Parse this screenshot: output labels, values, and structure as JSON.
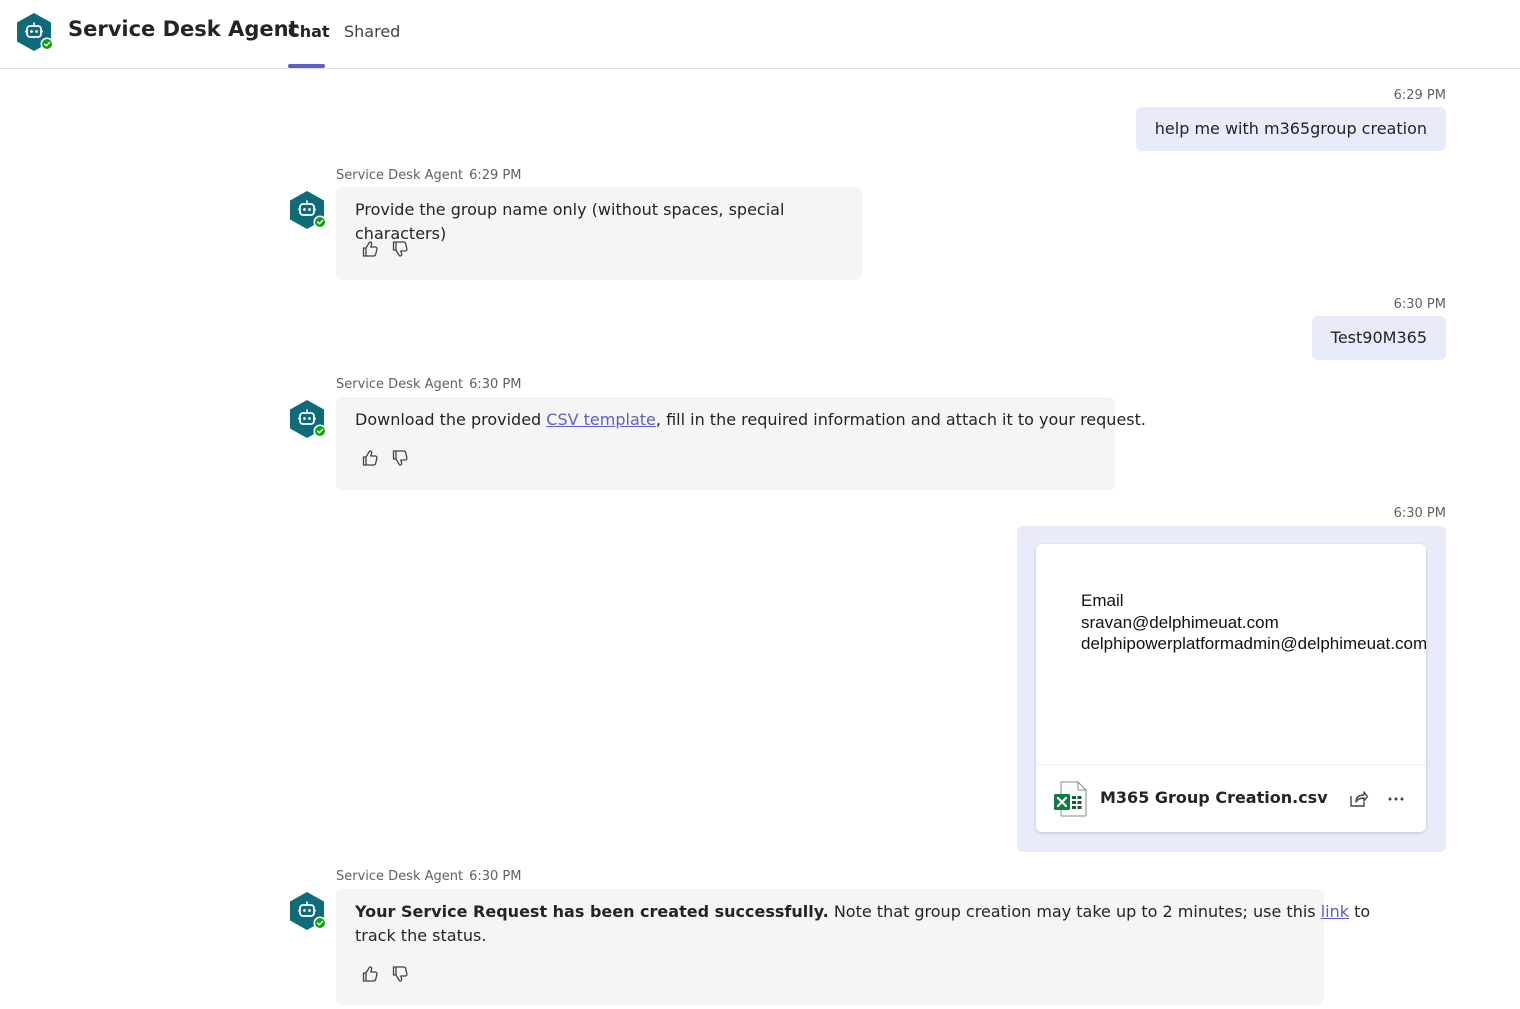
{
  "app": {
    "title": "Service Desk Agent",
    "tabs": [
      {
        "label": "Chat",
        "active": true
      },
      {
        "label": "Shared",
        "active": false
      }
    ],
    "accent_color": "#5b5fc7",
    "avatar_color": "#0f6b7a",
    "status_color": "#13a10e",
    "icons": {
      "avatar": "bot-hexagon-icon",
      "status": "available-check-icon",
      "like": "thumbs-up-icon",
      "dislike": "thumbs-down-icon",
      "file": "excel-csv-icon",
      "share": "share-icon",
      "more": "more-options-icon"
    }
  },
  "messages": [
    {
      "time": "6:29 PM",
      "text": "help me with m365group creation"
    },
    {
      "sender": "Service Desk Agent",
      "time": "6:29 PM",
      "text": "Provide the group name only (without spaces, special characters)"
    },
    {
      "time": "6:30 PM",
      "text": "Test90M365"
    },
    {
      "sender": "Service Desk Agent",
      "time": "6:30 PM",
      "text_before": "Download the provided ",
      "link": "CSV template",
      "text_after": ", fill in the required information and attach it to your request."
    },
    {
      "time": "6:30 PM",
      "file": {
        "name": "M365 Group Creation.csv",
        "preview_lines": [
          "Email",
          "sravan@delphimeuat.com",
          "delphipowerplatformadmin@delphimeuat.com"
        ]
      }
    },
    {
      "sender": "Service Desk Agent",
      "time": "6:30 PM",
      "bold": "Your Service Request has been created successfully.",
      "text_before": " Note that group creation may take up to 2 minutes; use this ",
      "link": "link",
      "text_after": " to",
      "line2": "track the status."
    }
  ]
}
